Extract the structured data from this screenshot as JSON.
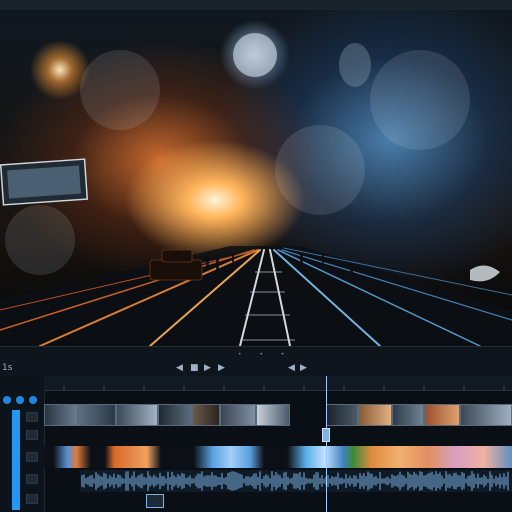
{
  "app": {
    "name": ""
  },
  "preview": {
    "description_colors": {
      "warm": "#ff9a3c",
      "cool": "#4aa3df",
      "sky": "#101820"
    }
  },
  "controls": {
    "left_label": "1s",
    "buttons": [
      "prev",
      "stop",
      "play",
      "next"
    ]
  },
  "timeline": {
    "tracks": [
      "video",
      "audio-spectrum",
      "audio-waveform"
    ],
    "accent": "#2196f3",
    "playhead_color": "#9ec9ff"
  }
}
